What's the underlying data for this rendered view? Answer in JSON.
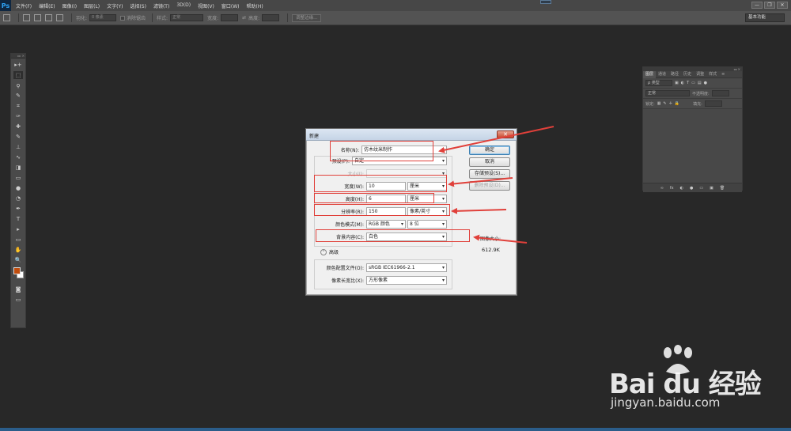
{
  "app": {
    "logo": "Ps",
    "menu": [
      "文件(F)",
      "编辑(E)",
      "图像(I)",
      "图层(L)",
      "文字(Y)",
      "选择(S)",
      "滤镜(T)",
      "3D(D)",
      "视图(V)",
      "窗口(W)",
      "帮助(H)"
    ],
    "window_controls": [
      "—",
      "❐",
      "✕"
    ]
  },
  "options_bar": {
    "feather_label": "羽化:",
    "feather_value": "0 像素",
    "antialias_label": "消除锯齿",
    "style_label": "样式:",
    "style_value": "正常",
    "width_label": "宽度:",
    "height_label": "高度:",
    "refine_edge": "调整边缘...",
    "workspace": "基本功能"
  },
  "tools": [
    "▸+",
    "⬚",
    "ϙ",
    "✎",
    "⌗",
    "✑",
    "✚",
    "✎",
    "⊥",
    "∿",
    "◨",
    "▭",
    "●",
    "◔",
    "✒",
    "T",
    "▸",
    "▭",
    "✋",
    "🔍"
  ],
  "layers_panel": {
    "tabs": [
      "图层",
      "通道",
      "路径",
      "历史",
      "调整",
      "样式"
    ],
    "kind_filter": "ρ 类型",
    "blend_mode": "正常",
    "opacity_label": "不透明度:",
    "lock_label": "锁定:",
    "fill_label": "填充:",
    "bottom_icons": [
      "∞",
      "fx",
      "◐",
      "●",
      "▭",
      "▣",
      "🗑"
    ]
  },
  "dialog": {
    "title": "新建",
    "close": "✕",
    "name_label": "名称(N):",
    "name_value": "仿木纹米制作",
    "preset_label": "预设(P):",
    "preset_value": "自定",
    "size_label": "大小(I):",
    "width_label": "宽度(W):",
    "width_value": "10",
    "width_unit": "厘米",
    "height_label": "高度(H):",
    "height_value": "6",
    "height_unit": "厘米",
    "resolution_label": "分辨率(R):",
    "resolution_value": "150",
    "resolution_unit": "像素/英寸",
    "color_mode_label": "颜色模式(M):",
    "color_mode_value": "RGB 颜色",
    "bit_depth": "8 位",
    "background_label": "背景内容(C):",
    "background_value": "白色",
    "advanced": "高级",
    "color_profile_label": "颜色配置文件(O):",
    "color_profile_value": "sRGB IEC61966-2.1",
    "pixel_aspect_label": "像素长宽比(X):",
    "pixel_aspect_value": "方形像素",
    "ok": "确定",
    "cancel": "取消",
    "save_preset": "存储预设(S)...",
    "delete_preset": "删除预设(D)...",
    "image_size_label": "图像大小:",
    "image_size_value": "612.9K"
  },
  "colors": {
    "foreground": "#c04d0e",
    "background": "#ffffff",
    "annotation": "#e0403a"
  },
  "watermark": {
    "brand": "Bai du 经验",
    "url": "jingyan.baidu.com"
  }
}
